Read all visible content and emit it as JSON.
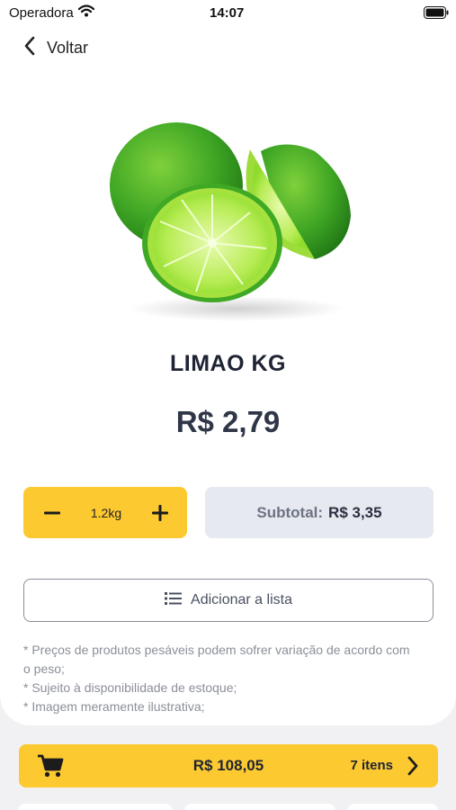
{
  "status_bar": {
    "carrier": "Operadora",
    "time": "14:07",
    "icons": [
      "wifi-icon",
      "battery-icon"
    ]
  },
  "nav": {
    "back_label": "Voltar",
    "icon": "chevron-left-icon"
  },
  "product": {
    "name": "LIMAO KG",
    "price": "R$ 2,79",
    "image": "lime-image"
  },
  "quantity": {
    "value": "1.2kg",
    "minus_icon": "minus-icon",
    "plus_icon": "plus-icon"
  },
  "subtotal": {
    "label": "Subtotal:",
    "value": "R$ 3,35"
  },
  "add_to_list": {
    "label": "Adicionar a lista",
    "icon": "list-icon"
  },
  "notes": [
    "* Preços de produtos pesáveis podem sofrer variação de acordo com o peso;",
    "* Sujeito à disponibilidade de estoque;",
    "* Imagem meramente ilustrativa;"
  ],
  "cart": {
    "total": "R$ 108,05",
    "count": "7 itens",
    "icon": "cart-icon"
  },
  "colors": {
    "accent": "#fcc930",
    "subtotal_bg": "#e6e9ef",
    "text_dark": "#1f2433",
    "text_muted": "#8b8f99"
  }
}
